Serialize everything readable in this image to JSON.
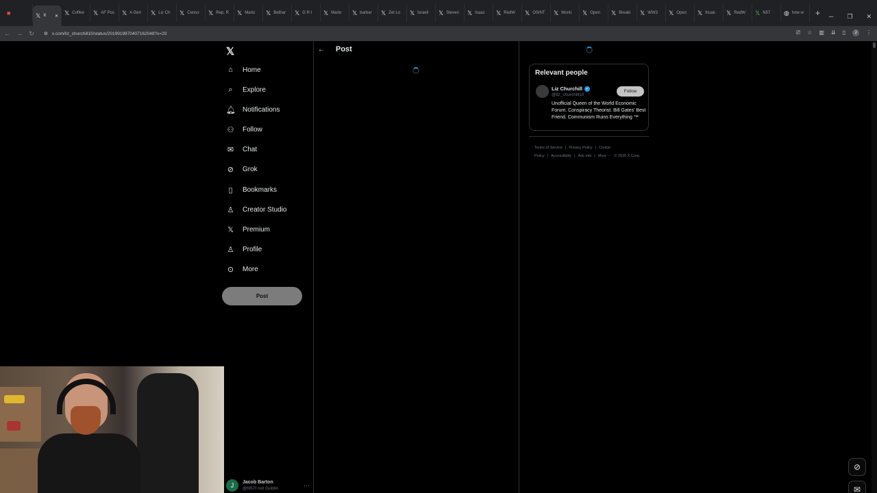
{
  "browser": {
    "tabs": [
      {
        "icon": "pinned-icon",
        "label": "",
        "active": false
      },
      {
        "icon": "x-logo-icon",
        "label": "X",
        "active": true
      },
      {
        "icon": "x-logo-icon",
        "label": "Coffee",
        "active": false
      },
      {
        "icon": "x-logo-icon",
        "label": "AF Pos",
        "active": false
      },
      {
        "icon": "x-logo-icon",
        "label": "A Gen",
        "active": false
      },
      {
        "icon": "x-logo-icon",
        "label": "Liz Ch",
        "active": false
      },
      {
        "icon": "x-logo-icon",
        "label": "Censo",
        "active": false
      },
      {
        "icon": "x-logo-icon",
        "label": "Rep. R",
        "active": false
      },
      {
        "icon": "x-logo-icon",
        "label": "Mario",
        "active": false
      },
      {
        "icon": "x-logo-icon",
        "label": "Bethar",
        "active": false
      },
      {
        "icon": "x-logo-icon",
        "label": "G R I",
        "active": false
      },
      {
        "icon": "x-logo-icon",
        "label": "Mario",
        "active": false
      },
      {
        "icon": "x-logo-icon",
        "label": "barbar",
        "active": false
      },
      {
        "icon": "x-logo-icon",
        "label": "Zet Lo",
        "active": false
      },
      {
        "icon": "x-logo-icon",
        "label": "Israeli",
        "active": false
      },
      {
        "icon": "x-logo-icon",
        "label": "Steven",
        "active": false
      },
      {
        "icon": "x-logo-icon",
        "label": "Isaac",
        "active": false
      },
      {
        "icon": "x-logo-icon",
        "label": "RedW",
        "active": false
      },
      {
        "icon": "x-logo-icon",
        "label": "OSINT",
        "active": false
      },
      {
        "icon": "x-logo-icon",
        "label": "Monti",
        "active": false
      },
      {
        "icon": "x-logo-icon",
        "label": "Open",
        "active": false
      },
      {
        "icon": "x-logo-icon",
        "label": "Breaki",
        "active": false
      },
      {
        "icon": "x-logo-icon",
        "label": "WW3",
        "active": false
      },
      {
        "icon": "x-logo-icon",
        "label": "Open",
        "active": false
      },
      {
        "icon": "x-logo-icon",
        "label": "Itsuai",
        "active": false
      },
      {
        "icon": "x-logo-icon",
        "label": "RedW",
        "active": false
      },
      {
        "icon": "x-logo-icon",
        "label": "N57",
        "active": false
      },
      {
        "icon": "globe-icon",
        "label": "how w",
        "active": false
      }
    ],
    "new_tab": "+",
    "url": "x.com/liz_churchill10/status/2019919970407162048?s=20"
  },
  "nav": {
    "items": [
      {
        "icon": "home-icon",
        "glyph": "⌂",
        "label": "Home"
      },
      {
        "icon": "search-icon",
        "glyph": "⌕",
        "label": "Explore"
      },
      {
        "icon": "bell-icon",
        "glyph": "🔔︎",
        "label": "Notifications"
      },
      {
        "icon": "follow-icon",
        "glyph": "⚇",
        "label": "Follow"
      },
      {
        "icon": "mail-icon",
        "glyph": "✉",
        "label": "Chat"
      },
      {
        "icon": "grok-icon",
        "glyph": "⊘",
        "label": "Grok"
      },
      {
        "icon": "bookmark-icon",
        "glyph": "▯",
        "label": "Bookmarks"
      },
      {
        "icon": "creator-studio-icon",
        "glyph": "♙",
        "label": "Creator Studio"
      },
      {
        "icon": "x-logo-icon",
        "glyph": "𝕏",
        "label": "Premium"
      },
      {
        "icon": "profile-icon",
        "glyph": "♙",
        "label": "Profile"
      },
      {
        "icon": "more-icon",
        "glyph": "⊙",
        "label": "More"
      }
    ],
    "post_button": "Post",
    "account": {
      "initial": "J",
      "name": "Jacob Barton",
      "handle": "@N57I not GobIln"
    }
  },
  "main": {
    "back_icon": "arrow-left-icon",
    "title": "Post"
  },
  "sidebar": {
    "relevant_people_title": "Relevant people",
    "person": {
      "name": "Liz Churchill",
      "handle": "@liz_churchill10",
      "follow_label": "Follow",
      "bio": "Unofficial Queen of the World Economic Forum. Conspiracy Theorist. Bill Gates' Best Friend. Communism Ruins Everything ™"
    },
    "footer_links": [
      "Terms of Service",
      "|",
      "Privacy Policy",
      "|",
      "Cookie Policy",
      "|",
      "Accessibility",
      "|",
      "Ads info",
      "|",
      "More ···",
      "© 2026 X Corp."
    ]
  },
  "colors": {
    "background": "#000000",
    "accent": "#1d9bf0",
    "border": "#2f3336",
    "muted_text": "#6e767d"
  }
}
